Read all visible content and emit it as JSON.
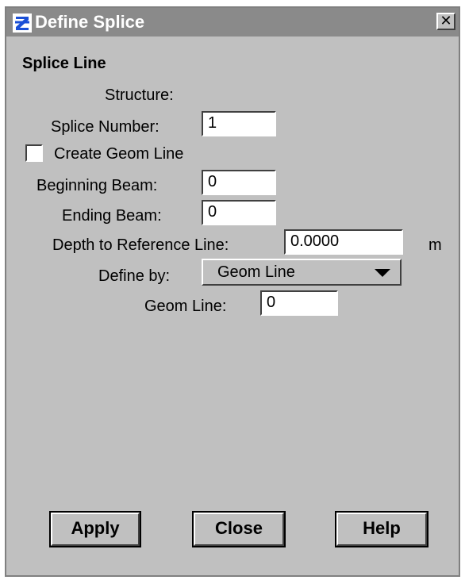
{
  "window": {
    "title": "Define Splice",
    "close_label": "✕"
  },
  "section": {
    "title": "Splice Line"
  },
  "structure": {
    "label": "Structure:"
  },
  "splice_number": {
    "label": "Splice Number:",
    "value": "1"
  },
  "create_geom_line": {
    "label": "Create Geom Line",
    "checked": false
  },
  "beginning_beam": {
    "label": "Beginning Beam:",
    "value": "0"
  },
  "ending_beam": {
    "label": "Ending Beam:",
    "value": "0"
  },
  "depth_reference": {
    "label": "Depth to Reference Line:",
    "value": "0.0000",
    "unit": "m"
  },
  "define_by": {
    "label": "Define by:",
    "value": "Geom Line"
  },
  "geom_line": {
    "label": "Geom Line:",
    "value": "0"
  },
  "buttons": {
    "apply": "Apply",
    "close": "Close",
    "help": "Help"
  },
  "colors": {
    "titlebar": "#8a8a8a",
    "window_bg": "#c0c0c0",
    "icon_blue": "#1a4fd6"
  },
  "icons": {
    "app": "app-logo-icon",
    "close": "close-icon",
    "dropdown": "chevron-down-icon"
  }
}
